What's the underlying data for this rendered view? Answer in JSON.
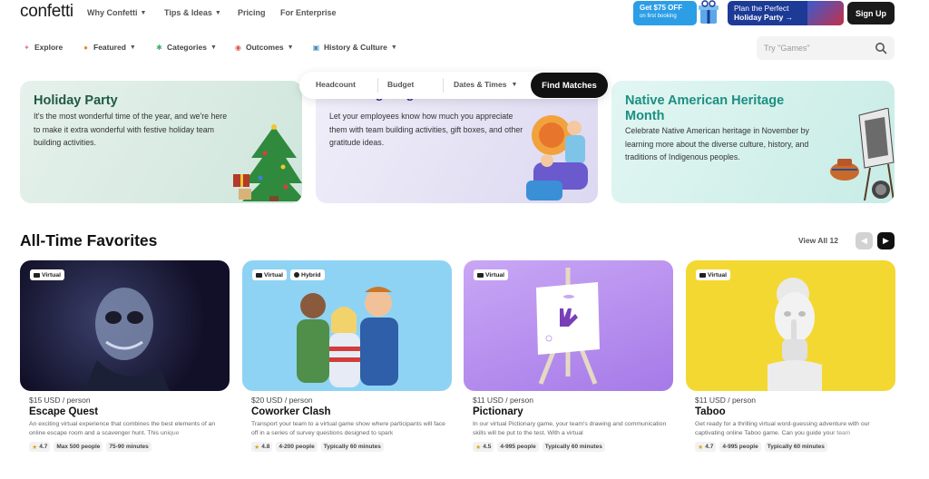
{
  "header": {
    "logo": "confetti",
    "nav": [
      {
        "label": "Why Confetti"
      },
      {
        "label": "Tips & Ideas"
      },
      {
        "label": "Pricing"
      },
      {
        "label": "For Enterprise"
      }
    ],
    "promo1": {
      "line1": "Get $75 OFF",
      "line2": "on first booking"
    },
    "promo2": {
      "line1": "Plan the Perfect",
      "line2": "Holiday Party →"
    },
    "signup": "Sign Up"
  },
  "subnav": {
    "items": [
      {
        "label": "Explore",
        "icon": "compass-icon"
      },
      {
        "label": "Featured",
        "icon": "flame-icon"
      },
      {
        "label": "Categories",
        "icon": "puzzle-icon"
      },
      {
        "label": "Outcomes",
        "icon": "target-icon"
      },
      {
        "label": "History & Culture",
        "icon": "book-icon"
      }
    ],
    "search_placeholder": "Try \"Games\""
  },
  "finder": {
    "headcount": "Headcount",
    "budget": "Budget",
    "dates": "Dates & Times",
    "button": "Find Matches"
  },
  "banners": [
    {
      "title": "Holiday Party",
      "description": "It's the most wonderful time of the year, and we're here to make it extra wonderful with festive holiday team building activities."
    },
    {
      "title": "Thanksgiving",
      "description": "Let your employees know how much you appreciate them with team building activities, gift boxes, and other gratitude ideas."
    },
    {
      "title": "Native American Heritage Month",
      "description": "Celebrate Native American heritage in November by learning more about the diverse culture, history, and traditions of Indigenous peoples."
    }
  ],
  "favorites": {
    "title": "All-Time Favorites",
    "view_all": "View All 12",
    "cards": [
      {
        "tags": [
          "Virtual"
        ],
        "price": "$15 USD / person",
        "title": "Escape Quest",
        "description": "An exciting virtual experience that combines the best elements of an online escape room and a scavenger hunt. This unique",
        "rating": "4.7",
        "people": "Max 500 people",
        "duration": "75-90 minutes"
      },
      {
        "tags": [
          "Virtual",
          "Hybrid"
        ],
        "price": "$20 USD / person",
        "title": "Coworker Clash",
        "description": "Transport your team to a virtual game show where participants will face off in a series of survey questions designed to spark",
        "rating": "4.8",
        "people": "4-200 people",
        "duration": "Typically 60 minutes"
      },
      {
        "tags": [
          "Virtual"
        ],
        "price": "$11 USD / person",
        "title": "Pictionary",
        "description": "In our virtual Pictionary game, your team's drawing and communication skills will be put to the test. With a virtual",
        "rating": "4.5",
        "people": "4-995 people",
        "duration": "Typically 60 minutes"
      },
      {
        "tags": [
          "Virtual"
        ],
        "price": "$11 USD / person",
        "title": "Taboo",
        "description": "Get ready for a thrilling virtual word-guessing adventure with our captivating online Taboo game. Can you guide your team",
        "rating": "4.7",
        "people": "4-995 people",
        "duration": "Typically 60 minutes"
      }
    ]
  }
}
